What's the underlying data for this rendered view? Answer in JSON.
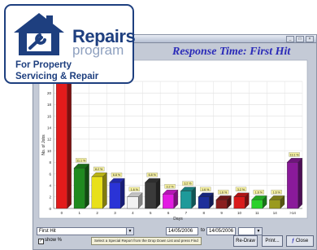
{
  "logo": {
    "word1": "Repairs",
    "word2": "program",
    "tagline_line1": "For Property",
    "tagline_line2": "Servicing & Repair"
  },
  "window": {
    "controls": [
      "_",
      "□",
      "×"
    ]
  },
  "chart_data": {
    "type": "bar",
    "title": "Response Time: First Hit",
    "xlabel": "Days",
    "ylabel": "No. of Jobs",
    "categories": [
      "0",
      "1",
      "2",
      "3",
      "4",
      "5",
      "6",
      "7",
      "8",
      "9",
      "10",
      "11",
      "14",
      ">14"
    ],
    "values": [
      32,
      7,
      5.5,
      4.5,
      2,
      4.5,
      2.5,
      3,
      2,
      1.5,
      2,
      1.5,
      1.5,
      8
    ],
    "data_labels": [
      "",
      "11.1 %",
      "8.2 %",
      "6.8 %",
      "1.6 %",
      "6.8 %",
      "3.2 %",
      "3.2 %",
      "1.6 %",
      "1.6 %",
      "3.2 %",
      "1.6 %",
      "1.6 %",
      "13.1 %"
    ],
    "colors": [
      "#e31b1b",
      "#1f8a1f",
      "#e8e01a",
      "#2a33d6",
      "#f2f2f2",
      "#3a3a3a",
      "#e21be2",
      "#1f9a9a",
      "#1d2f9a",
      "#8a1f1f",
      "#d91a1a",
      "#2ad12a",
      "#9a9a1f",
      "#8a1a9a"
    ],
    "y_ticks": [
      "22",
      "20",
      "18",
      "16",
      "14",
      "12",
      "10",
      "8",
      "6",
      "4",
      "2",
      "0"
    ],
    "ylim": [
      0,
      22
    ],
    "grid": true,
    "label_bg": "#f5f0a0"
  },
  "controls": {
    "report_select": "First Hit",
    "date_from": "14/05/2006",
    "to_label": "to",
    "date_to": "14/05/2006",
    "show_percent_label": "show %",
    "show_percent_checked": "✓",
    "hint": "Select a Special Report from the Drop Down List and press Find",
    "redraw_label": "Re-Draw",
    "print_label": "Print...",
    "close_label": "Close"
  }
}
